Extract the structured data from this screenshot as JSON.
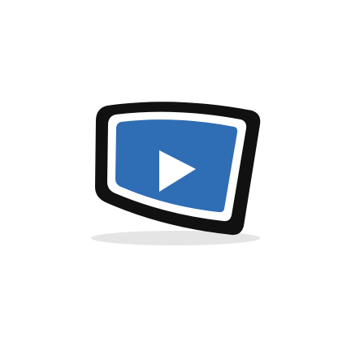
{
  "icon": {
    "name": "video-player-icon",
    "colors": {
      "background": "#ffffff",
      "frame": "#111111",
      "inner_border": "#ffffff",
      "screen": "#2f6db5",
      "play": "#ffffff",
      "shadow": "#e5e5e5"
    }
  }
}
